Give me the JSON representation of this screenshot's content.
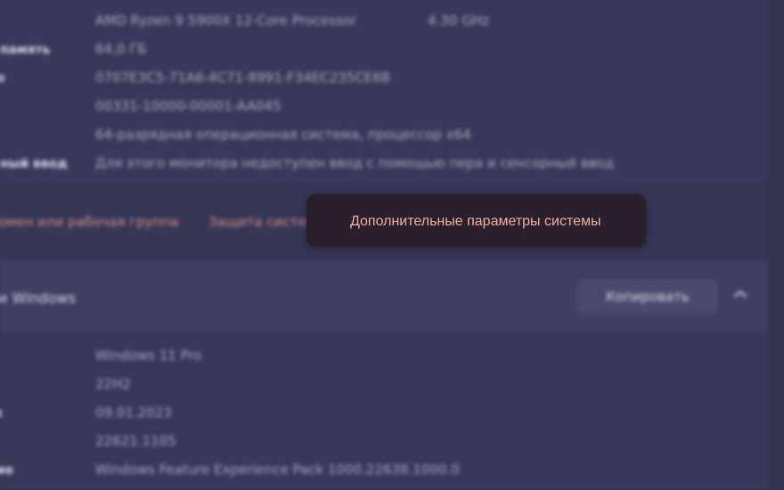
{
  "device_specs": {
    "processor_value": "AMD Ryzen 9 5900X 12-Core Processor",
    "processor_speed": "4.30 GHz",
    "ram_label": "память",
    "ram_value": "64,0 ГБ",
    "device_id_value": "0707E3C5-71A6-4C71-8991-F34EC235CE6B",
    "product_id_value": "00331-10000-00001-AA045",
    "system_type_value": "64-разрядная операционная система, процессор x64",
    "pen_touch_label": "ный ввод",
    "pen_touch_value": "Для этого монитора недоступен ввод с помощью пера и сенсорный ввод"
  },
  "related_links": {
    "domain_link": "омен или рабочая группа",
    "protection_link": "Защита системы"
  },
  "tooltip": {
    "text": "Дополнительные параметры системы"
  },
  "windows_specs": {
    "title": "и Windows",
    "copy_button": "Копировать",
    "edition_value": "Windows 11 Pro",
    "version_value": "22H2",
    "installed_on_value": "09.01.2023",
    "build_value": "22621.1105",
    "experience_label": "ие",
    "experience_value": "Windows Feature Experience Pack 1000.22638.1000.0"
  },
  "icons": {
    "chevron": "chevron-up-icon"
  }
}
